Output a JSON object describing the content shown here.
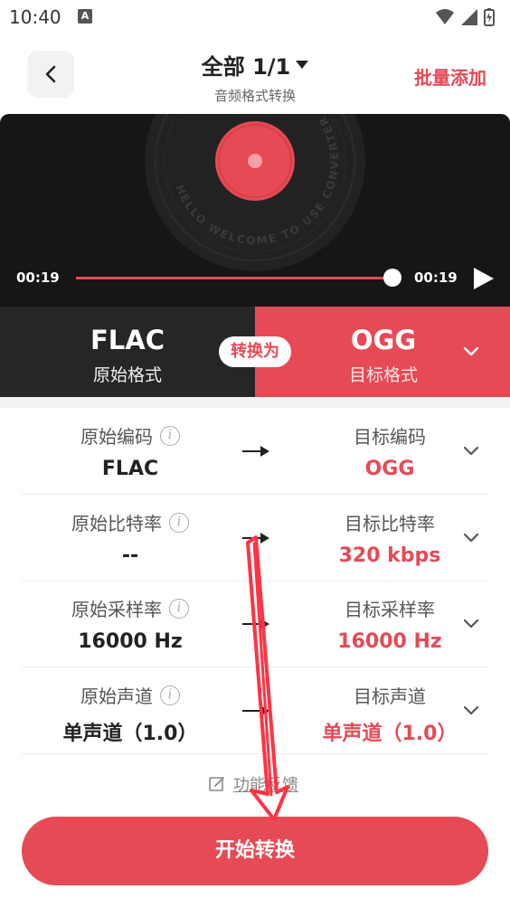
{
  "status": {
    "time": "10:40",
    "app_badge": "A"
  },
  "header": {
    "title": "全部 1/1",
    "subtitle": "音频格式转换",
    "batch_add": "批量添加"
  },
  "player": {
    "disc_text": "HELLO WELCOME TO USE CONVERTER",
    "current_time": "00:19",
    "total_time": "00:19",
    "progress": 1.0
  },
  "format": {
    "source_name": "FLAC",
    "source_label": "原始格式",
    "convert_label": "转换为",
    "target_name": "OGG",
    "target_label": "目标格式"
  },
  "params": [
    {
      "left_label": "原始编码",
      "left_value": "FLAC",
      "right_label": "目标编码",
      "right_value": "OGG"
    },
    {
      "left_label": "原始比特率",
      "left_value": "--",
      "right_label": "目标比特率",
      "right_value": "320 kbps"
    },
    {
      "left_label": "原始采样率",
      "left_value": "16000 Hz",
      "right_label": "目标采样率",
      "right_value": "16000 Hz"
    },
    {
      "left_label": "原始声道",
      "left_value": "单声道（1.0）",
      "right_label": "目标声道",
      "right_value": "单声道（1.0）"
    }
  ],
  "feedback": "功能反馈",
  "start_button": "开始转换",
  "colors": {
    "accent": "#e64a55",
    "dark": "#262626",
    "player_bg": "#161616"
  },
  "icons": [
    "back-icon",
    "caret-down-icon",
    "play-icon",
    "chevron-down-icon",
    "info-icon",
    "arrow-right-icon",
    "edit-icon"
  ]
}
